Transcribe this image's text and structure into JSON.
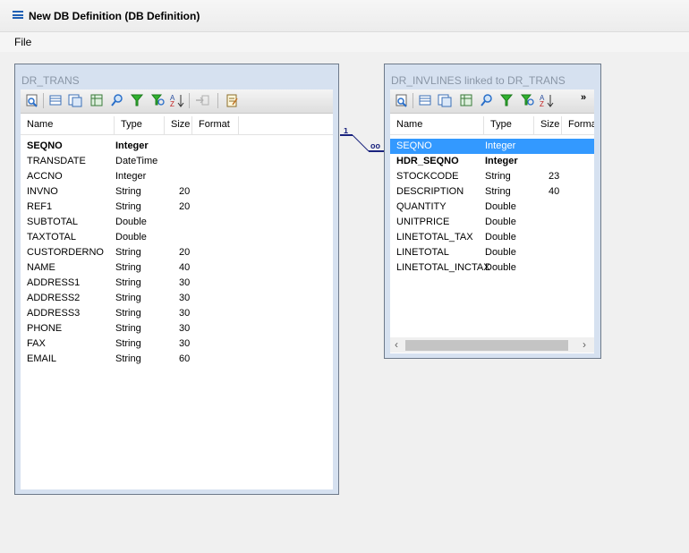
{
  "window": {
    "title": "New DB Definition (DB Definition)"
  },
  "menu": {
    "file": "File"
  },
  "relation": {
    "one_label": "1",
    "many_label": "oo"
  },
  "icons": [
    "preview-icon",
    "table-icon",
    "columns-icon",
    "grid-icon",
    "search-icon",
    "filter-icon",
    "filter-search-icon",
    "sort-az-icon",
    "import-icon",
    "notes-icon"
  ],
  "colors": {
    "selection": "#3399ff",
    "panel_border": "#6e7a8a",
    "relation_line": "#1a237e"
  },
  "left_panel": {
    "title": "DR_TRANS",
    "columns": [
      "Name",
      "Type",
      "Size",
      "Format"
    ],
    "rows": [
      {
        "name": "SEQNO",
        "type": "Integer",
        "size": "",
        "bold": true
      },
      {
        "name": "TRANSDATE",
        "type": "DateTime",
        "size": ""
      },
      {
        "name": "ACCNO",
        "type": "Integer",
        "size": ""
      },
      {
        "name": "INVNO",
        "type": "String",
        "size": "20"
      },
      {
        "name": "REF1",
        "type": "String",
        "size": "20"
      },
      {
        "name": "SUBTOTAL",
        "type": "Double",
        "size": ""
      },
      {
        "name": "TAXTOTAL",
        "type": "Double",
        "size": ""
      },
      {
        "name": "CUSTORDERNO",
        "type": "String",
        "size": "20"
      },
      {
        "name": "NAME",
        "type": "String",
        "size": "40"
      },
      {
        "name": "ADDRESS1",
        "type": "String",
        "size": "30"
      },
      {
        "name": "ADDRESS2",
        "type": "String",
        "size": "30"
      },
      {
        "name": "ADDRESS3",
        "type": "String",
        "size": "30"
      },
      {
        "name": "PHONE",
        "type": "String",
        "size": "30"
      },
      {
        "name": "FAX",
        "type": "String",
        "size": "30"
      },
      {
        "name": "EMAIL",
        "type": "String",
        "size": "60"
      }
    ]
  },
  "right_panel": {
    "title": "DR_INVLINES linked to DR_TRANS",
    "columns": [
      "Name",
      "Type",
      "Size",
      "Forma"
    ],
    "more": "»",
    "rows": [
      {
        "name": "SEQNO",
        "type": "Integer",
        "size": "",
        "selected": true
      },
      {
        "name": "HDR_SEQNO",
        "type": "Integer",
        "size": "",
        "bold": true
      },
      {
        "name": "STOCKCODE",
        "type": "String",
        "size": "23"
      },
      {
        "name": "DESCRIPTION",
        "type": "String",
        "size": "40"
      },
      {
        "name": "QUANTITY",
        "type": "Double",
        "size": ""
      },
      {
        "name": "UNITPRICE",
        "type": "Double",
        "size": ""
      },
      {
        "name": "LINETOTAL_TAX",
        "type": "Double",
        "size": ""
      },
      {
        "name": "LINETOTAL",
        "type": "Double",
        "size": ""
      },
      {
        "name": "LINETOTAL_INCTAX",
        "type": "Double",
        "size": ""
      }
    ]
  }
}
